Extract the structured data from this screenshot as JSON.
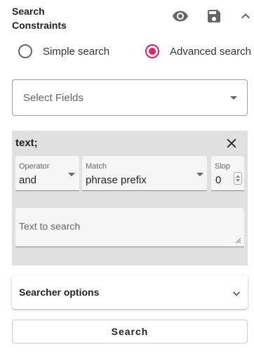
{
  "header": {
    "title": "Search Constraints",
    "icons": [
      "eye-icon",
      "save-icon",
      "chevron-up-icon"
    ]
  },
  "search_mode": {
    "options": [
      {
        "label": "Simple search",
        "selected": false
      },
      {
        "label": "Advanced search",
        "selected": true
      }
    ],
    "accent_color": "#e91e63"
  },
  "fields_select": {
    "placeholder": "Select Fields"
  },
  "clause": {
    "title": "text;",
    "operator": {
      "label": "Operator",
      "value": "and"
    },
    "match": {
      "label": "Match",
      "value": "phrase prefix"
    },
    "slop": {
      "label": "Slop",
      "value": "0"
    },
    "text_placeholder": "Text to search",
    "background": "#e0e0e0"
  },
  "searcher_options": {
    "label": "Searcher options"
  },
  "search_button": {
    "label": "Search"
  }
}
